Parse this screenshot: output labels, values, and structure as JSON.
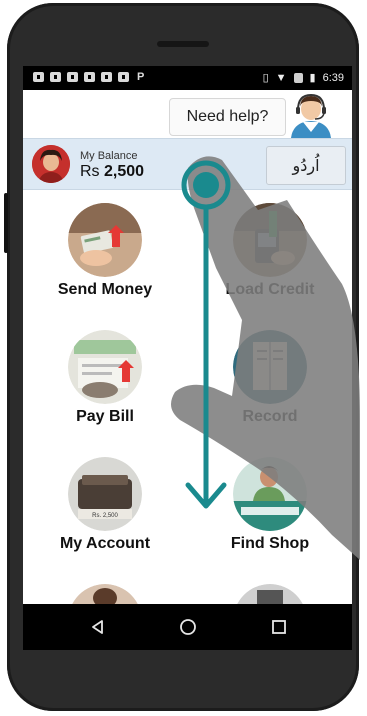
{
  "status_bar": {
    "time": "6:39",
    "left_icons": [
      "notification-icon",
      "notification-icon",
      "notification-icon",
      "notification-icon",
      "notification-icon",
      "notification-icon",
      "paypal-icon"
    ],
    "right_icons": [
      "vibrate-icon",
      "wifi-icon",
      "signal-icon",
      "battery-icon"
    ]
  },
  "help": {
    "label": "Need help?",
    "agent_icon": "support-agent-icon"
  },
  "balance": {
    "label": "My Balance",
    "currency": "Rs",
    "amount": "2,500",
    "language_button": "اُردُو"
  },
  "menu": [
    {
      "label": "Send Money",
      "icon": "send-money-icon"
    },
    {
      "label": "Load Credit",
      "icon": "load-credit-icon"
    },
    {
      "label": "Pay Bill",
      "icon": "pay-bill-icon"
    },
    {
      "label": "Record",
      "icon": "record-icon"
    },
    {
      "label": "My Account",
      "icon": "wallet-icon"
    },
    {
      "label": "Find Shop",
      "icon": "find-shop-icon"
    }
  ],
  "nav": {
    "icons": [
      "back-icon",
      "home-icon",
      "recents-icon"
    ]
  },
  "tutorial": {
    "gesture": "swipe-down",
    "colors": {
      "arrow": "#1a8a8e",
      "hand": "#7d7d7d"
    }
  },
  "colors": {
    "balance_bar": "#dde9f4",
    "phone_frame": "#2b2b2b",
    "accent_red": "#e53935"
  }
}
